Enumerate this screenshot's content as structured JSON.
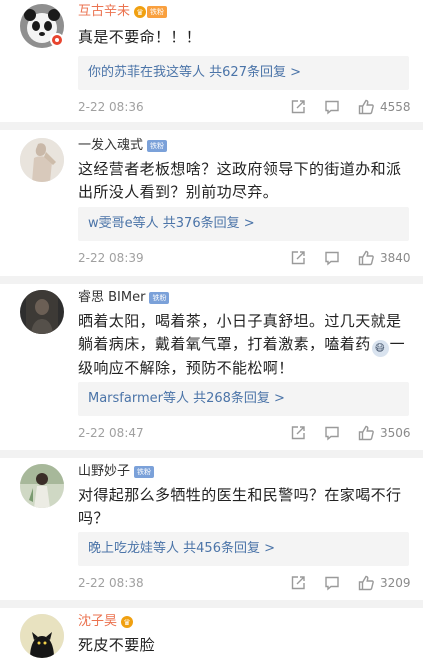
{
  "comments": [
    {
      "username": "互古辛未",
      "badge": "铁粉",
      "text": "真是不要命！！！",
      "replies_users": "你的苏菲在我这等人",
      "replies_total": "共627条回复 >",
      "time": "2-22 08:36",
      "likes": "4558"
    },
    {
      "username": "一发入魂式",
      "badge": "铁粉",
      "text": "这经营者老板想啥？这政府领导下的街道办和派出所没人看到？别前功尽弃。",
      "replies_users": "w雯哥e等人",
      "replies_total": "共376条回复 >",
      "time": "2-22 08:39",
      "likes": "3840"
    },
    {
      "username": "睿思 BIMer",
      "badge": "铁粉",
      "text_before_emoji": "晒着太阳，喝着茶，小日子真舒坦。过几天就是躺着病床，戴着氧气罩，打着激素，嗑着药",
      "text_after_emoji": "一级响应不解除，预防不能松啊！",
      "replies_users": "Marsfarmer等人",
      "replies_total": "共268条回复 >",
      "time": "2-22 08:47",
      "likes": "3506"
    },
    {
      "username": "山野妙子",
      "badge": "铁粉",
      "text": "对得起那么多牺牲的医生和民警吗？在家喝不行吗？",
      "replies_users": "晚上吃龙娃等人",
      "replies_total": "共456条回复 >",
      "time": "2-22 08:38",
      "likes": "3209"
    },
    {
      "username": "沈子昊",
      "text": "死皮不要脸"
    }
  ],
  "colors": {
    "name_highlight": "#eb7350",
    "reply_link": "#4b74a8",
    "meta_gray": "#a0a0a0",
    "divider": "#f2f2f2"
  },
  "icons": {
    "share": "share-icon",
    "comment": "comment-icon",
    "like": "thumbs-up-icon",
    "vip": "crown-icon"
  }
}
